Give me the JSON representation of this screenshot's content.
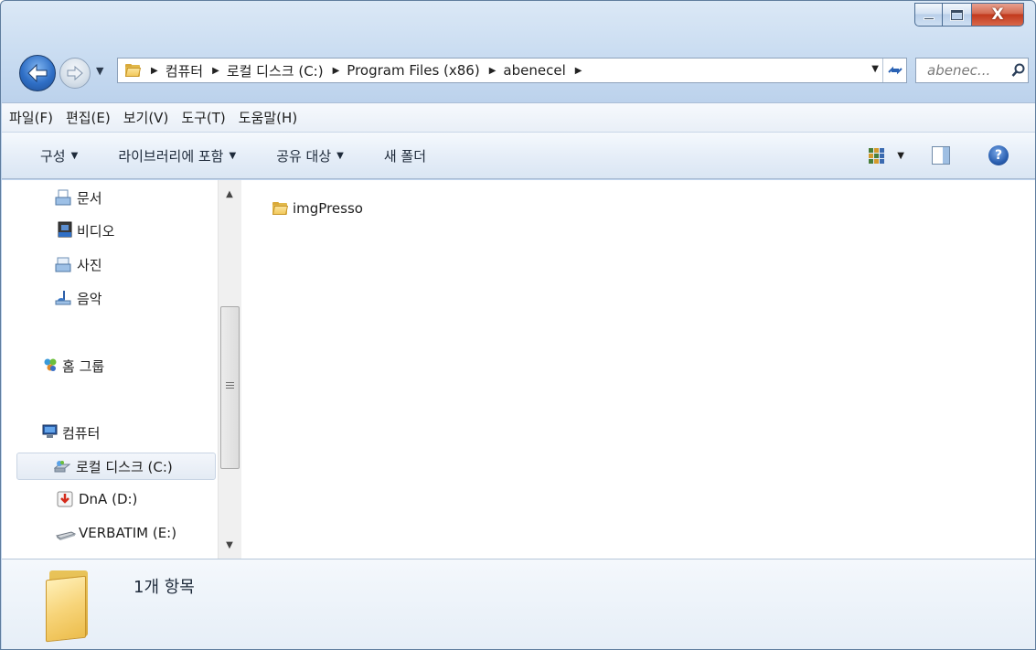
{
  "window": {
    "minimize_label": "",
    "maximize_label": "",
    "close_label": "X"
  },
  "navigation": {
    "back_icon": "back-arrow-icon",
    "forward_icon": "forward-arrow-icon",
    "breadcrumbs": [
      "컴퓨터",
      "로컬 디스크 (C:)",
      "Program Files (x86)",
      "abenecel"
    ],
    "search_placeholder": "abenec..."
  },
  "menu": {
    "items": [
      "파일(F)",
      "편집(E)",
      "보기(V)",
      "도구(T)",
      "도움말(H)"
    ]
  },
  "commands": {
    "organize": "구성",
    "include_in_library": "라이브러리에 포함",
    "share_with": "공유 대상",
    "new_folder": "새 폴더",
    "help": "?"
  },
  "nav_pane": {
    "items": [
      {
        "label": "문서",
        "icon": "documents-icon"
      },
      {
        "label": "비디오",
        "icon": "videos-icon"
      },
      {
        "label": "사진",
        "icon": "pictures-icon"
      },
      {
        "label": "음악",
        "icon": "music-icon"
      },
      {
        "label": "홈 그룹",
        "icon": "homegroup-icon"
      },
      {
        "label": "컴퓨터",
        "icon": "computer-icon"
      },
      {
        "label": "로컬 디스크 (C:)",
        "icon": "local-disk-icon",
        "selected": true
      },
      {
        "label": "DnA (D:)",
        "icon": "drive-d-icon"
      },
      {
        "label": "VERBATIM (E:)",
        "icon": "removable-drive-icon"
      }
    ]
  },
  "content": {
    "files": [
      {
        "name": "imgPresso",
        "type": "folder"
      }
    ]
  },
  "details": {
    "item_count": "1개 항목"
  },
  "colors": {
    "title_gradient": "#c9dcf1",
    "selected_bg": "#e4ebf4",
    "folder_yellow": "#f2c95c",
    "close_red": "#c2391d"
  }
}
